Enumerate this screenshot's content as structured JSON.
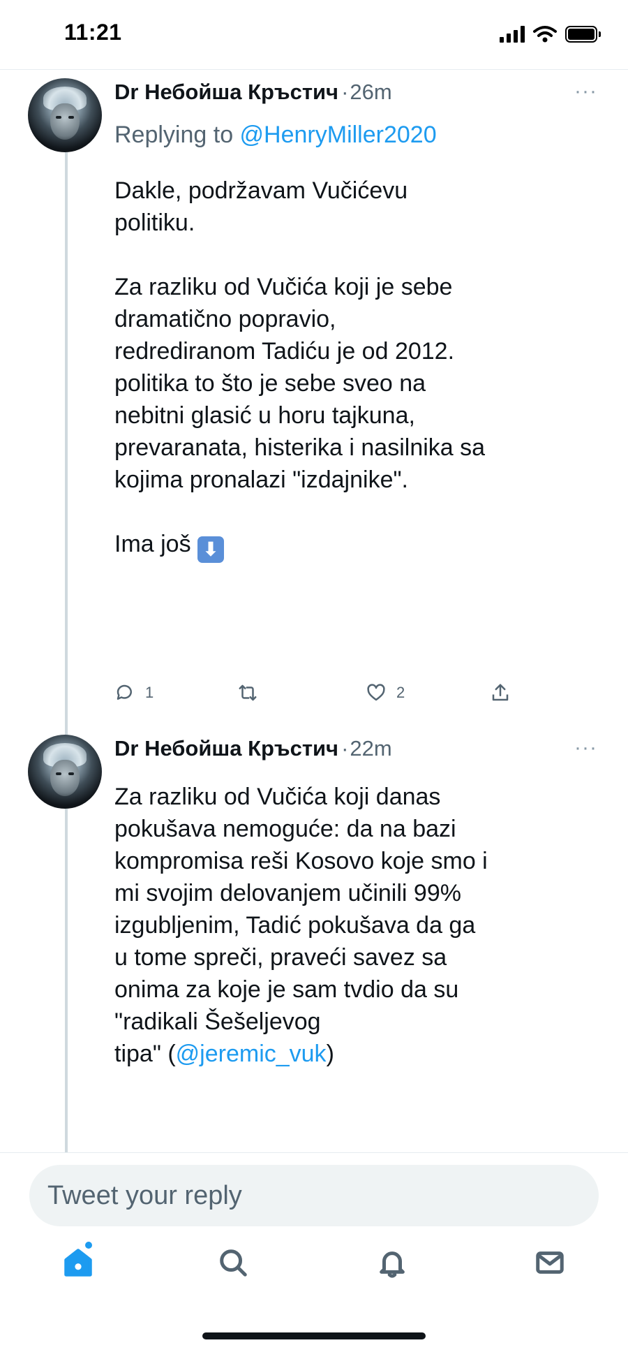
{
  "status_bar": {
    "time": "11:21",
    "icons": [
      "cellular-signal-icon",
      "wifi-icon",
      "battery-icon"
    ]
  },
  "colors": {
    "accent": "#1d9bf0",
    "text": "#0f1419",
    "secondary": "#536471",
    "thread_line": "#cfd9de",
    "composer_bg": "#eff3f4"
  },
  "tweets": [
    {
      "author": "Dr Небойша Кръстич",
      "separator": "·",
      "time": "26m",
      "replying_prefix": "Replying to ",
      "replying_handle": "@HenryMiller2020",
      "text": "Dakle, podržavam Vučićevu\npolitiku.\n\nZa razliku od Vučića koji je sebe\ndramatično popravio,\nredrediranom Tadiću je od 2012.\npolitika to što je sebe sveo na\nnebitni glasić u horu tajkuna,\nprevaranata, histerika i nasilnika sa\nkojima pronalazi \"izdajnike\".\n\nIma još ",
      "emoji": "⬇",
      "more": "···",
      "actions": {
        "reply_count": "1",
        "retweet_count": "",
        "like_count": "2"
      }
    },
    {
      "author": "Dr Небойша Кръстич",
      "separator": "·",
      "time": "22m",
      "text": "Za razliku od Vučića koji danas\npokušava nemoguće: da na bazi\nkompromisa reši Kosovo koje smo i\nmi svojim delovanjem učinili 99%\nizgubljenim, Tadić pokušava da ga\nu tome spreči, praveći savez sa\nonima za koje je sam tvdio da su\n\"radikali Šešeljevog\ntipa\" (",
      "mention": "@jeremic_vuk",
      "text_end": ")",
      "more": "···"
    }
  ],
  "composer": {
    "placeholder": "Tweet your reply"
  },
  "bottom_nav": {
    "items": [
      "home-icon",
      "search-icon",
      "notifications-icon",
      "messages-icon"
    ],
    "active": "home"
  }
}
